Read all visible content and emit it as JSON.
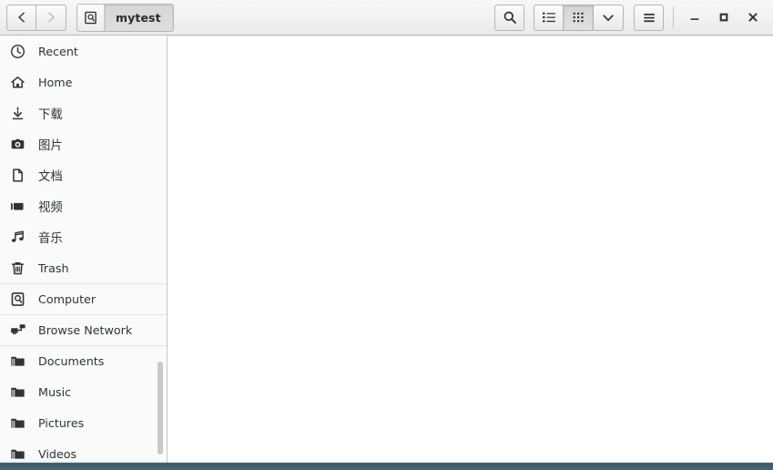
{
  "window": {
    "title": "mytest",
    "controls": {
      "minimize_label": "–",
      "maximize_label": "□",
      "close_label": "×"
    }
  },
  "headerbar": {
    "back_tooltip": "Back",
    "forward_tooltip": "Forward",
    "path_button_label": "mytest",
    "path_button_icon": "computer-icon",
    "search_icon": "search-icon",
    "view_list_icon": "list-view-icon",
    "view_grid_icon": "grid-view-icon",
    "view_options_icon": "chevron-down-icon",
    "menu_icon": "hamburger-menu-icon"
  },
  "sidebar": {
    "items": [
      {
        "label": "Recent",
        "icon": "clock-icon",
        "cjk": false,
        "separator_above": false
      },
      {
        "label": "Home",
        "icon": "home-icon",
        "cjk": false,
        "separator_above": false
      },
      {
        "label": "下载",
        "icon": "download-icon",
        "cjk": true,
        "separator_above": false
      },
      {
        "label": "图片",
        "icon": "camera-icon",
        "cjk": true,
        "separator_above": false
      },
      {
        "label": "文档",
        "icon": "document-icon",
        "cjk": true,
        "separator_above": false
      },
      {
        "label": "视频",
        "icon": "video-icon",
        "cjk": true,
        "separator_above": false
      },
      {
        "label": "音乐",
        "icon": "music-icon",
        "cjk": true,
        "separator_above": false
      },
      {
        "label": "Trash",
        "icon": "trash-icon",
        "cjk": false,
        "separator_above": false
      },
      {
        "label": "Computer",
        "icon": "computer-icon",
        "cjk": false,
        "separator_above": true
      },
      {
        "label": "Browse Network",
        "icon": "network-icon",
        "cjk": false,
        "separator_above": true
      },
      {
        "label": "Documents",
        "icon": "folder-icon",
        "cjk": false,
        "separator_above": true
      },
      {
        "label": "Music",
        "icon": "folder-icon",
        "cjk": false,
        "separator_above": false
      },
      {
        "label": "Pictures",
        "icon": "folder-icon",
        "cjk": false,
        "separator_above": false
      },
      {
        "label": "Videos",
        "icon": "folder-icon",
        "cjk": false,
        "separator_above": false
      }
    ]
  },
  "main": {
    "empty": ""
  },
  "colors": {
    "header_top": "#f7f7f7",
    "header_bottom": "#eaeaea",
    "sidebar_bg": "#fafafa",
    "main_bg": "#ffffff",
    "text": "#2e3436",
    "border": "#c6c6c6",
    "desktop": "#44606d",
    "active_button": "#d8d8d8"
  }
}
